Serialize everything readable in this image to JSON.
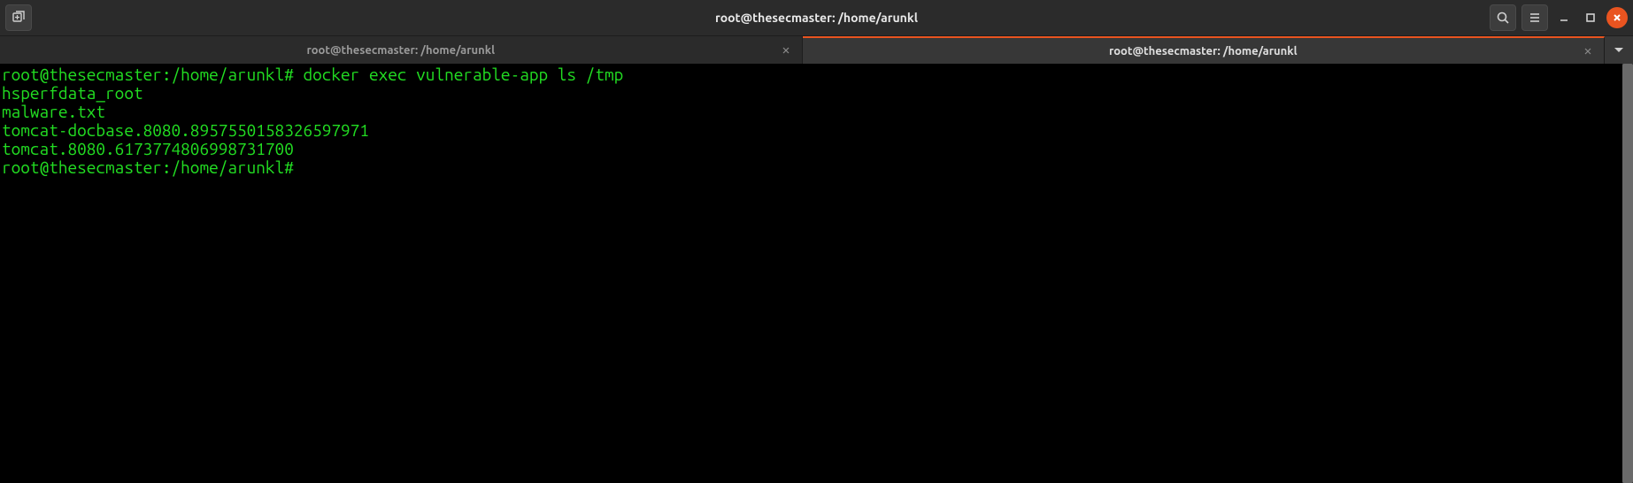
{
  "window": {
    "title": "root@thesecmaster: /home/arunkl"
  },
  "tabs": [
    {
      "label": "root@thesecmaster: /home/arunkl",
      "active": false
    },
    {
      "label": "root@thesecmaster: /home/arunkl",
      "active": true
    }
  ],
  "terminal": {
    "prompt": "root@thesecmaster:/home/arunkl#",
    "command": "docker exec vulnerable-app ls /tmp",
    "output": [
      "hsperfdata_root",
      "malware.txt",
      "tomcat-docbase.8080.8957550158326597971",
      "tomcat.8080.6173774806998731700"
    ],
    "prompt2": "root@thesecmaster:/home/arunkl#"
  },
  "icons": {
    "new_tab": "new-tab-icon",
    "search": "search-icon",
    "menu": "hamburger-icon",
    "minimize": "minimize-icon",
    "maximize": "maximize-icon",
    "close": "close-icon",
    "dropdown": "chevron-down-icon"
  }
}
